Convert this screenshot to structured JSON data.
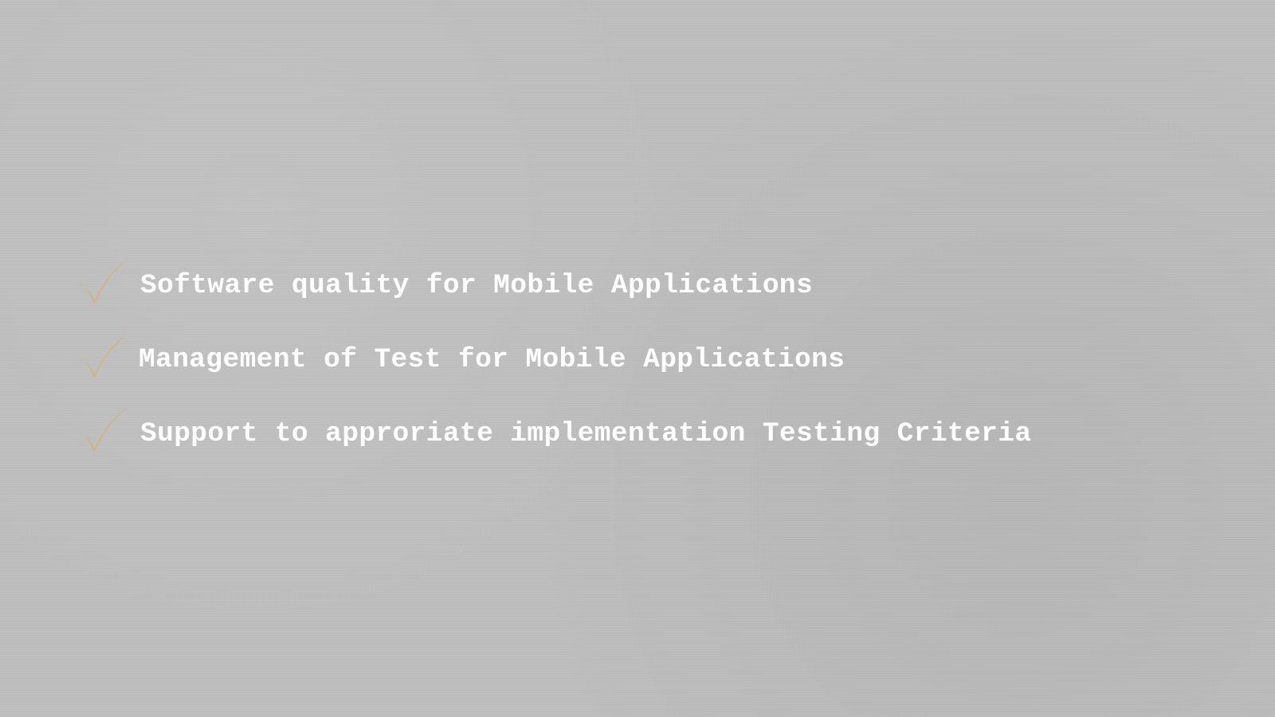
{
  "slide": {
    "bullets": [
      {
        "text": "Software quality for Mobile Applications",
        "icon": "checkmark-icon"
      },
      {
        "text": "Management of Test for Mobile Applications",
        "icon": "checkmark-icon"
      },
      {
        "text": "Support to approriate implementation Testing Criteria",
        "icon": "checkmark-icon"
      }
    ]
  },
  "colors": {
    "background": "#bebebe",
    "text": "#ffffff",
    "checkmark": "#d5b27a"
  }
}
